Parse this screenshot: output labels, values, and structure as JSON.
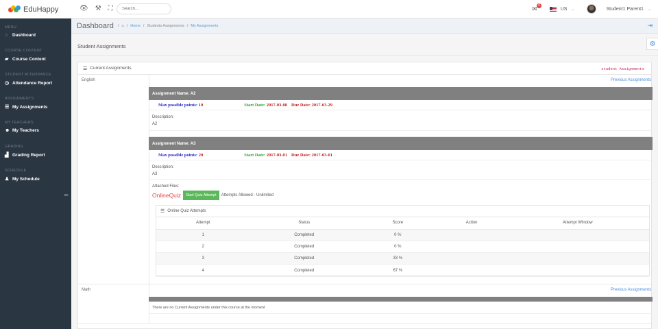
{
  "app": {
    "name": "EduHappy"
  },
  "topbar": {
    "search_placeholder": "Search...",
    "mail_count": "4",
    "language": "US",
    "user_name": "Student1 Parent1"
  },
  "sidebar": {
    "sections": [
      {
        "title": "MENU",
        "item": "Dashboard",
        "icon": "home-icon"
      },
      {
        "title": "COURSE CONTENT",
        "item": "Course Content",
        "icon": "book-icon"
      },
      {
        "title": "STUDENT ATTENDANCE",
        "item": "Attendance Report",
        "icon": "clock-icon"
      },
      {
        "title": "ASSIGNMENTS",
        "item": "My Assignments",
        "icon": "list-icon"
      },
      {
        "title": "MY TEACHERS",
        "item": "My Teachers",
        "icon": "users-icon"
      },
      {
        "title": "GRADING",
        "item": "Grading Report",
        "icon": "bar-chart-icon"
      },
      {
        "title": "SCHEDULE",
        "item": "My Schedule",
        "icon": "bell-icon"
      }
    ]
  },
  "breadcrumb": {
    "title": "Dashboard",
    "home": "Home",
    "level1": "Students Assignments",
    "level2": "My Assignments"
  },
  "page": {
    "heading": "Student Assignments"
  },
  "portlet": {
    "title": "Current Assignments",
    "code_label": "student Assignments"
  },
  "courses": {
    "english": {
      "name": "English",
      "prev_link": "Previous Assignments",
      "assignments": [
        {
          "header": "Assignment Name: A2",
          "max_label": "Max possible points:",
          "max_value": "10",
          "start_label": "Start Date:",
          "start_value": "2017-03-08",
          "due_label": "Due Date:",
          "due_value": "2017-03-29",
          "desc_label": "Description:",
          "desc_value": "A2"
        },
        {
          "header": "Assignment Name: A3",
          "max_label": "Max possible points:",
          "max_value": "20",
          "start_label": "Start Date:",
          "start_value": "2017-03-01",
          "due_label": "Due Date:",
          "due_value": "2017-03-01",
          "desc_label": "Description:",
          "desc_value": "A3",
          "files_label": "Attached Files:",
          "quiz_name": "OnlineQuiz",
          "quiz_button": "Start Quiz Attempt",
          "attempts_text": "Attempts Allowed - Unlimited"
        }
      ]
    },
    "math": {
      "name": "Math",
      "prev_link": "Previous Assignments",
      "empty_message": "There are no Current Assignments under this course at the moment"
    }
  },
  "quiz_attempts": {
    "title": "Online Quiz Attempts",
    "columns": [
      "Attempt",
      "Status",
      "Score",
      "Action",
      "Attempt Window"
    ],
    "rows": [
      [
        "1",
        "Completed",
        "0 %",
        "",
        ""
      ],
      [
        "2",
        "Completed",
        "0 %",
        "",
        ""
      ],
      [
        "3",
        "Completed",
        "33 %",
        "",
        ""
      ],
      [
        "4",
        "Completed",
        "67 %",
        "",
        ""
      ]
    ]
  },
  "colors": {
    "sidebar_bg": "#2b3643",
    "assignment_header": "#808080",
    "link": "#4b8cdc",
    "quiz_button": "#5cb85c",
    "quiz_name": "#e04545"
  }
}
